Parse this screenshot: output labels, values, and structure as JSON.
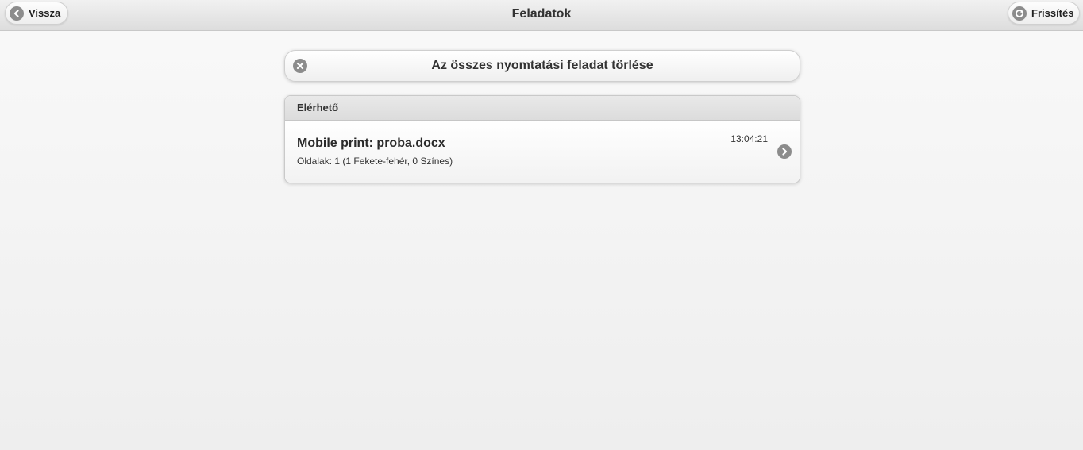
{
  "header": {
    "title": "Feladatok",
    "back_label": "Vissza",
    "back_icon": "chevron-left-icon",
    "refresh_label": "Frissítés",
    "refresh_icon": "refresh-icon"
  },
  "delete_all": {
    "label": "Az összes nyomtatási feladat törlése",
    "icon": "close-icon"
  },
  "jobs_list": {
    "divider_label": "Elérhető",
    "items": [
      {
        "title": "Mobile print: proba.docx",
        "subtitle": "Oldalak: 1 (1 Fekete-fehér, 0 Színes)",
        "time": "13:04:21",
        "icon": "chevron-right-icon"
      }
    ]
  },
  "colors": {
    "icon_gray": "#8c8c8c",
    "text": "#333333",
    "background": "#f2f2f2"
  }
}
